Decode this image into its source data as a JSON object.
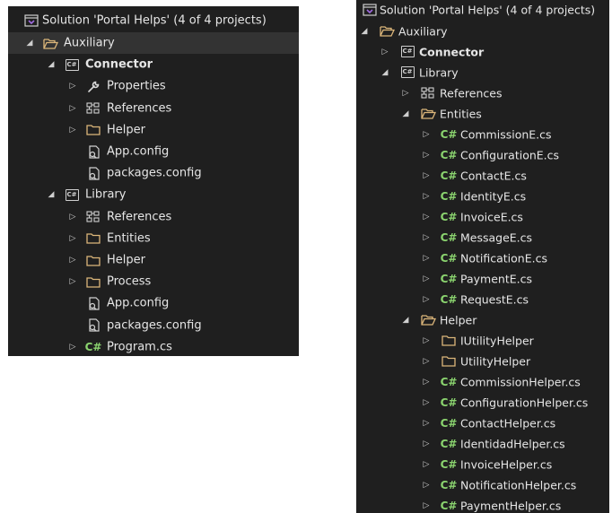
{
  "left": {
    "solution_title": "Solution 'Portal Helps' (4 of 4 projects)",
    "rows": [
      {
        "label": "Auxiliary",
        "indent": 0,
        "twisty": "open",
        "icon": "folder-open-icon",
        "selected": true
      },
      {
        "label": "Connector",
        "indent": 1,
        "twisty": "open",
        "icon": "csharp-project-icon",
        "bold": true
      },
      {
        "label": "Properties",
        "indent": 2,
        "twisty": "closed",
        "icon": "wrench-icon"
      },
      {
        "label": "References",
        "indent": 2,
        "twisty": "closed",
        "icon": "references-icon"
      },
      {
        "label": "Helper",
        "indent": 2,
        "twisty": "closed",
        "icon": "folder-icon"
      },
      {
        "label": "App.config",
        "indent": 2,
        "twisty": "none",
        "icon": "config-file-icon"
      },
      {
        "label": "packages.config",
        "indent": 2,
        "twisty": "none",
        "icon": "config-file-icon"
      },
      {
        "label": "Library",
        "indent": 1,
        "twisty": "open",
        "icon": "csharp-project-icon"
      },
      {
        "label": "References",
        "indent": 2,
        "twisty": "closed",
        "icon": "references-icon"
      },
      {
        "label": "Entities",
        "indent": 2,
        "twisty": "closed",
        "icon": "folder-icon"
      },
      {
        "label": "Helper",
        "indent": 2,
        "twisty": "closed",
        "icon": "folder-icon"
      },
      {
        "label": "Process",
        "indent": 2,
        "twisty": "closed",
        "icon": "folder-icon"
      },
      {
        "label": "App.config",
        "indent": 2,
        "twisty": "none",
        "icon": "config-file-icon"
      },
      {
        "label": "packages.config",
        "indent": 2,
        "twisty": "none",
        "icon": "config-file-icon"
      },
      {
        "label": "Program.cs",
        "indent": 2,
        "twisty": "closed",
        "icon": "csharp-file-icon"
      }
    ]
  },
  "right": {
    "solution_title": "Solution 'Portal Helps' (4 of 4 projects)",
    "rows": [
      {
        "label": "Auxiliary",
        "indent": 0,
        "twisty": "open",
        "icon": "folder-open-icon"
      },
      {
        "label": "Connector",
        "indent": 1,
        "twisty": "closed",
        "icon": "csharp-project-icon",
        "bold": true
      },
      {
        "label": "Library",
        "indent": 1,
        "twisty": "open",
        "icon": "csharp-project-icon"
      },
      {
        "label": "References",
        "indent": 2,
        "twisty": "closed",
        "icon": "references-icon"
      },
      {
        "label": "Entities",
        "indent": 2,
        "twisty": "open",
        "icon": "folder-open-icon"
      },
      {
        "label": "CommissionE.cs",
        "indent": 3,
        "twisty": "closed",
        "icon": "csharp-file-icon"
      },
      {
        "label": "ConfigurationE.cs",
        "indent": 3,
        "twisty": "closed",
        "icon": "csharp-file-icon"
      },
      {
        "label": "ContactE.cs",
        "indent": 3,
        "twisty": "closed",
        "icon": "csharp-file-icon"
      },
      {
        "label": "IdentityE.cs",
        "indent": 3,
        "twisty": "closed",
        "icon": "csharp-file-icon"
      },
      {
        "label": "InvoiceE.cs",
        "indent": 3,
        "twisty": "closed",
        "icon": "csharp-file-icon"
      },
      {
        "label": "MessageE.cs",
        "indent": 3,
        "twisty": "closed",
        "icon": "csharp-file-icon"
      },
      {
        "label": "NotificationE.cs",
        "indent": 3,
        "twisty": "closed",
        "icon": "csharp-file-icon"
      },
      {
        "label": "PaymentE.cs",
        "indent": 3,
        "twisty": "closed",
        "icon": "csharp-file-icon"
      },
      {
        "label": "RequestE.cs",
        "indent": 3,
        "twisty": "closed",
        "icon": "csharp-file-icon"
      },
      {
        "label": "Helper",
        "indent": 2,
        "twisty": "open",
        "icon": "folder-open-icon"
      },
      {
        "label": "IUtilityHelper",
        "indent": 3,
        "twisty": "closed",
        "icon": "folder-icon"
      },
      {
        "label": "UtilityHelper",
        "indent": 3,
        "twisty": "closed",
        "icon": "folder-icon"
      },
      {
        "label": "CommissionHelper.cs",
        "indent": 3,
        "twisty": "closed",
        "icon": "csharp-file-icon"
      },
      {
        "label": "ConfigurationHelper.cs",
        "indent": 3,
        "twisty": "closed",
        "icon": "csharp-file-icon"
      },
      {
        "label": "ContactHelper.cs",
        "indent": 3,
        "twisty": "closed",
        "icon": "csharp-file-icon"
      },
      {
        "label": "IdentidadHelper.cs",
        "indent": 3,
        "twisty": "closed",
        "icon": "csharp-file-icon"
      },
      {
        "label": "InvoiceHelper.cs",
        "indent": 3,
        "twisty": "closed",
        "icon": "csharp-file-icon"
      },
      {
        "label": "NotificationHelper.cs",
        "indent": 3,
        "twisty": "closed",
        "icon": "csharp-file-icon"
      },
      {
        "label": "PaymentHelper.cs",
        "indent": 3,
        "twisty": "closed",
        "icon": "csharp-file-icon"
      }
    ]
  },
  "colors": {
    "panel_bg": "#1f1f1f",
    "selected_row": "#333333",
    "folder": "#dcb67a",
    "csharp": "#8bd46f",
    "solution_icon": "#a06be0"
  }
}
